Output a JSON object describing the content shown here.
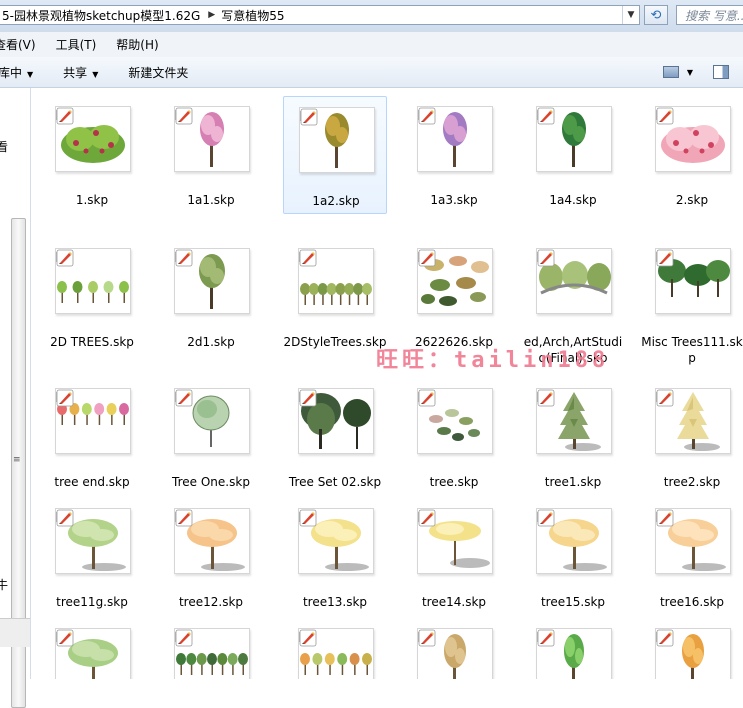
{
  "address": {
    "segments": [
      "5-园林景观植物sketchup模型1.62G",
      "写意植物55"
    ],
    "separator_icon": "chevron-right-icon",
    "dropdown_icon": "chevron-down-icon"
  },
  "refresh_icon": "refresh-icon",
  "search": {
    "placeholder": "搜索 写意..."
  },
  "menu": {
    "items": [
      "查看(V)",
      "工具(T)",
      "帮助(H)"
    ]
  },
  "toolbar": {
    "organize": "库中",
    "share": "共享",
    "new_folder": "新建文件夹"
  },
  "left_pane": {
    "text_top": "看",
    "text_bottom": "牛"
  },
  "watermark": "旺旺：tailin188",
  "colors": {
    "selection_bg": "#e8f2fe",
    "selection_border": "#b8d6fb",
    "watermark": "#f07a90",
    "sketchup_badge": "#d9432e"
  },
  "files": [
    {
      "name": "1.skp",
      "thumb": "green-shrub",
      "selected": false
    },
    {
      "name": "1a1.skp",
      "thumb": "pink-tree",
      "selected": false
    },
    {
      "name": "1a2.skp",
      "thumb": "autumn-tree",
      "selected": true
    },
    {
      "name": "1a3.skp",
      "thumb": "purple-tree",
      "selected": false
    },
    {
      "name": "1a4.skp",
      "thumb": "green-red-tree",
      "selected": false
    },
    {
      "name": "2.skp",
      "thumb": "pink-shrub",
      "selected": false
    },
    {
      "name": "2D TREES.skp",
      "thumb": "tree-group-small",
      "selected": false
    },
    {
      "name": "2d1.skp",
      "thumb": "round-tree",
      "selected": false
    },
    {
      "name": "2DStyleTrees.skp",
      "thumb": "tree-row-flat",
      "selected": false
    },
    {
      "name": "2622626.skp",
      "thumb": "mushroom-trees",
      "selected": false
    },
    {
      "name": "ed,Arch,ArtStudio(Final).skp",
      "thumb": "arch-trees",
      "selected": false
    },
    {
      "name": "Misc Trees111.skp",
      "thumb": "misc-trees",
      "selected": false
    },
    {
      "name": "tree end.skp",
      "thumb": "tree-dots",
      "selected": false
    },
    {
      "name": "Tree One.skp",
      "thumb": "sketch-tree",
      "selected": false
    },
    {
      "name": "Tree Set 02.skp",
      "thumb": "willow-trees",
      "selected": false
    },
    {
      "name": "tree.skp",
      "thumb": "scattered-trees",
      "selected": false
    },
    {
      "name": "tree1.skp",
      "thumb": "conifer-green",
      "selected": false
    },
    {
      "name": "tree2.skp",
      "thumb": "conifer-yellow",
      "selected": false
    },
    {
      "name": "tree11g.skp",
      "thumb": "light-green-tree",
      "selected": false
    },
    {
      "name": "tree12.skp",
      "thumb": "orange-tree",
      "selected": false
    },
    {
      "name": "tree13.skp",
      "thumb": "yellow-tree",
      "selected": false
    },
    {
      "name": "tree14.skp",
      "thumb": "flat-yellow-tree",
      "selected": false
    },
    {
      "name": "tree15.skp",
      "thumb": "yellow-tree-2",
      "selected": false
    },
    {
      "name": "tree16.skp",
      "thumb": "peach-tree",
      "selected": false
    },
    {
      "name": "",
      "thumb": "green-tree-partial",
      "selected": false
    },
    {
      "name": "",
      "thumb": "forest-partial",
      "selected": false
    },
    {
      "name": "",
      "thumb": "colorful-row-partial",
      "selected": false
    },
    {
      "name": "",
      "thumb": "brown-tree-partial",
      "selected": false
    },
    {
      "name": "",
      "thumb": "green-small-partial",
      "selected": false
    },
    {
      "name": "",
      "thumb": "orange-small-partial",
      "selected": false
    }
  ]
}
